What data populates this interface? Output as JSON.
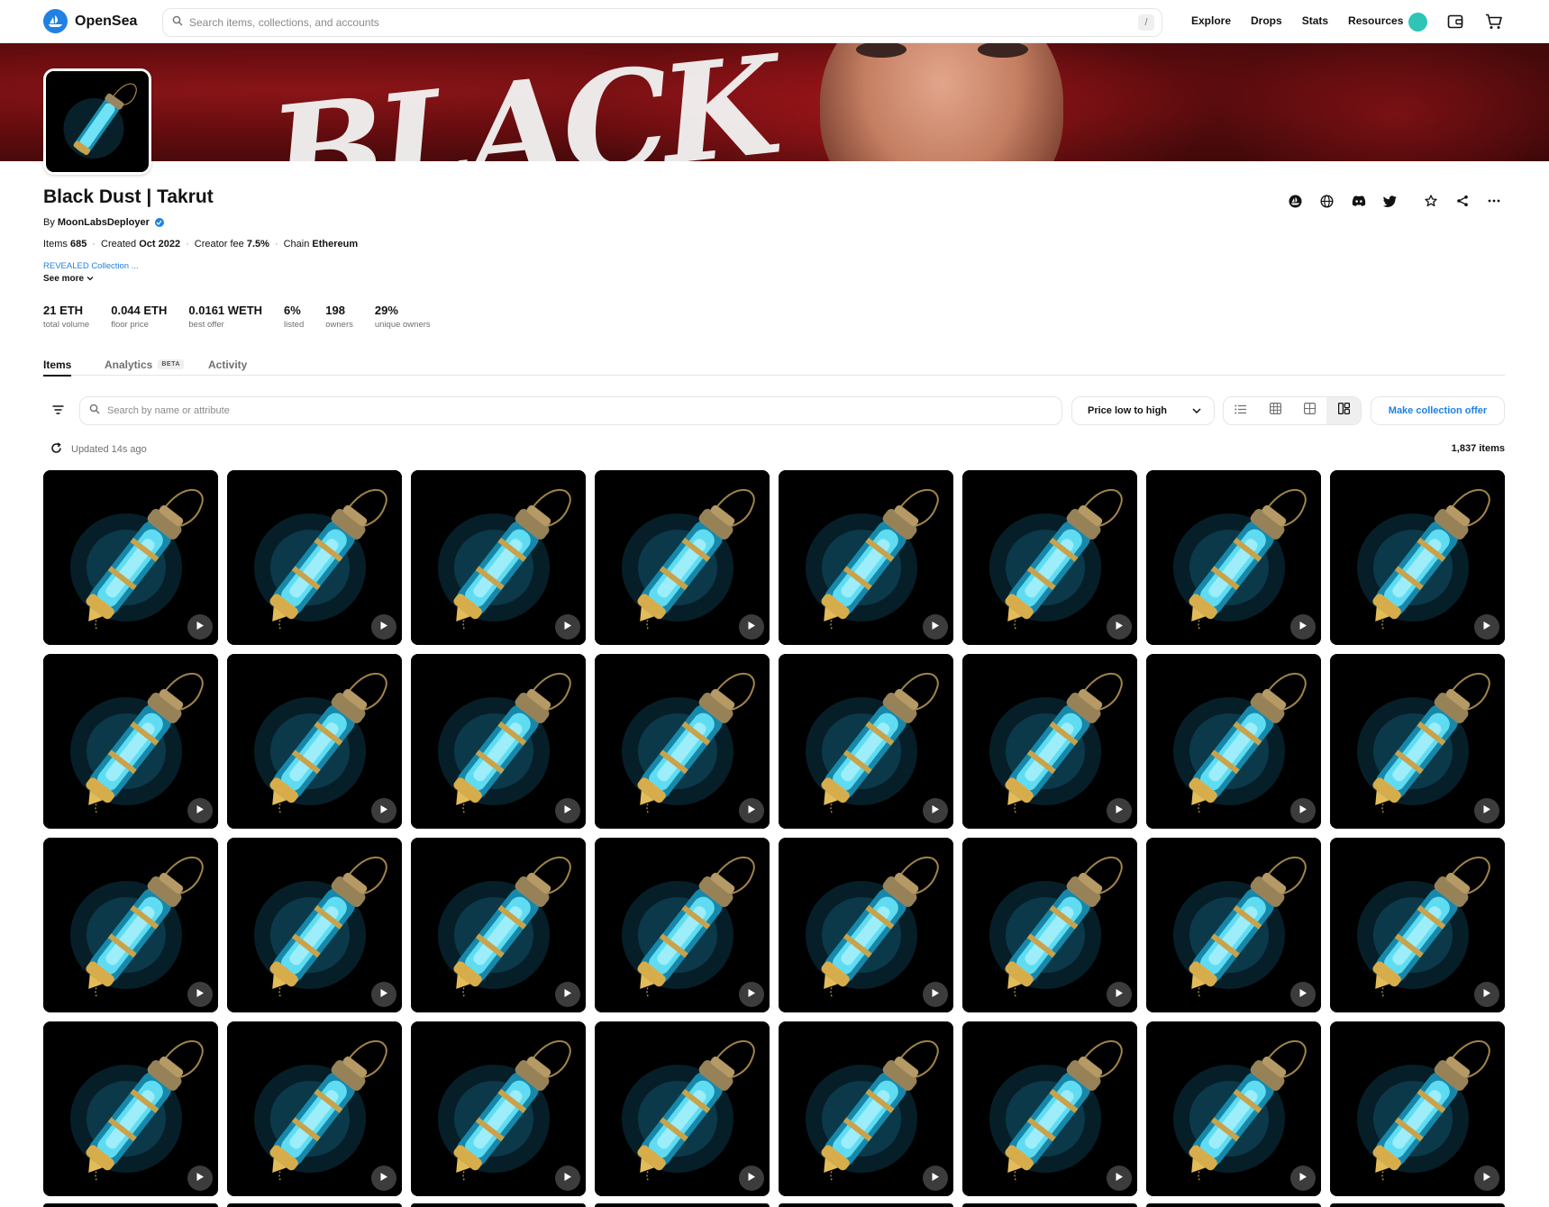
{
  "app": {
    "brand": "OpenSea",
    "search_placeholder": "Search items, collections, and accounts",
    "search_shortcut": "/",
    "nav": [
      "Explore",
      "Drops",
      "Stats",
      "Resources"
    ],
    "accent_color": "#2081e2"
  },
  "collection": {
    "name": "Black Dust | Takrut",
    "by_label": "By",
    "creator": "MoonLabsDeployer",
    "meta": [
      {
        "label": "Items",
        "value": "685"
      },
      {
        "label": "Created",
        "value": "Oct 2022"
      },
      {
        "label": "Creator fee",
        "value": "7.5%"
      },
      {
        "label": "Chain",
        "value": "Ethereum"
      }
    ],
    "description": "REVEALED Collection ...",
    "see_more": "See more",
    "stats": [
      {
        "value": "21 ETH",
        "label": "total volume"
      },
      {
        "value": "0.044 ETH",
        "label": "floor price"
      },
      {
        "value": "0.0161 WETH",
        "label": "best offer"
      },
      {
        "value": "6%",
        "label": "listed"
      },
      {
        "value": "198",
        "label": "owners"
      },
      {
        "value": "29%",
        "label": "unique owners"
      }
    ],
    "header_actions": [
      "opensea-icon",
      "globe-icon",
      "discord-icon",
      "twitter-icon",
      "star-icon",
      "share-icon",
      "more-icon"
    ]
  },
  "tabs": [
    {
      "label": "Items",
      "active": true
    },
    {
      "label": "Analytics",
      "badge": "BETA"
    },
    {
      "label": "Activity"
    }
  ],
  "toolbar": {
    "search_placeholder": "Search by name or attribute",
    "sort_value": "Price low to high",
    "view_modes": [
      "list-view-icon",
      "grid-small-icon",
      "grid-large-icon",
      "grid-compact-icon"
    ],
    "active_view": 3,
    "offer_button": "Make collection offer",
    "updated_text": "Updated 14s ago",
    "item_count": "1,837 items"
  },
  "grid": {
    "rows": 4,
    "columns": 8,
    "item_icon": "play-icon"
  }
}
